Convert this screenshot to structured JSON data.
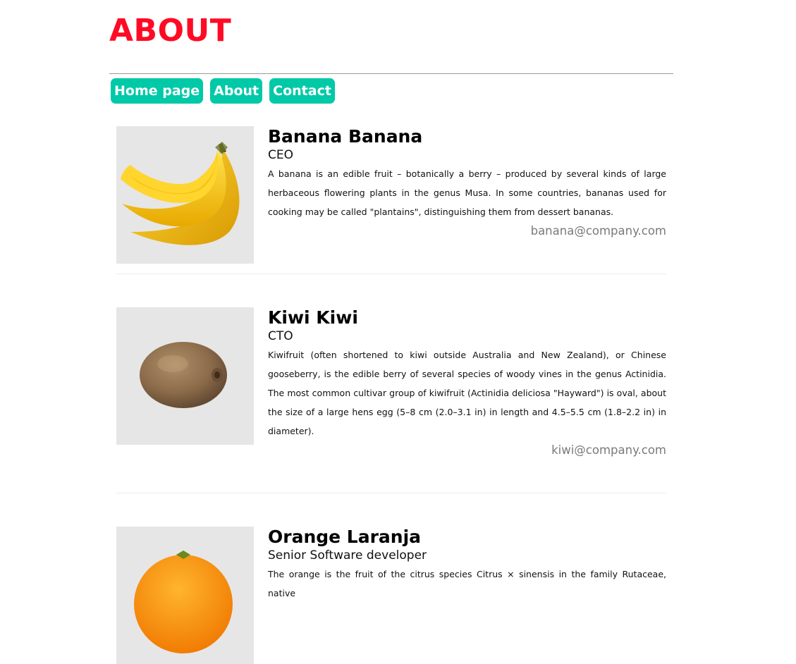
{
  "header": {
    "title": "ABOUT"
  },
  "nav": {
    "items": [
      {
        "label": "Home page"
      },
      {
        "label": "About"
      },
      {
        "label": "Contact"
      }
    ]
  },
  "colors": {
    "title": "#ff0a25",
    "nav_button": "#00c9a7",
    "email": "#7a7a7a"
  },
  "team": [
    {
      "name": "Banana Banana",
      "role": "CEO",
      "bio": "A banana is an edible fruit – botanically a berry – produced by several kinds of large herbaceous flowering plants in the genus Musa. In some countries, bananas used for cooking may be called \"plantains\", distinguishing them from dessert bananas.",
      "email": "banana@company.com",
      "photo": "banana-image"
    },
    {
      "name": "Kiwi Kiwi",
      "role": "CTO",
      "bio": "Kiwifruit (often shortened to kiwi outside Australia and New Zealand), or Chinese gooseberry, is the edible berry of several species of woody vines in the genus Actinidia. The most common cultivar group of kiwifruit (Actinidia deliciosa \"Hayward\") is oval, about the size of a large hens egg (5–8 cm (2.0–3.1 in) in length and 4.5–5.5 cm (1.8–2.2 in) in diameter).",
      "email": "kiwi@company.com",
      "photo": "kiwi-image"
    },
    {
      "name": "Orange Laranja",
      "role": "Senior Software developer",
      "bio": "The orange is the fruit of the citrus species Citrus × sinensis in the family Rutaceae, native",
      "email": "",
      "photo": "orange-image"
    }
  ]
}
